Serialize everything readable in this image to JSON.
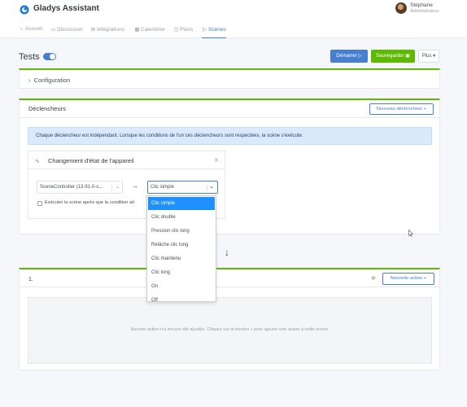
{
  "app": {
    "name": "Gladys Assistant"
  },
  "user": {
    "name": "Stéphane",
    "role": "Administrateur"
  },
  "nav": [
    {
      "label": "Accueil",
      "icon": "home-icon",
      "glyph": "⌂",
      "active": false
    },
    {
      "label": "Discussion",
      "icon": "chat-icon",
      "glyph": "▭",
      "active": false
    },
    {
      "label": "Intégrations",
      "icon": "grid-icon",
      "glyph": "⊞",
      "active": false
    },
    {
      "label": "Calendrier",
      "icon": "calendar-icon",
      "glyph": "▦",
      "active": false
    },
    {
      "label": "Plans",
      "icon": "map-icon",
      "glyph": "◫",
      "active": false
    },
    {
      "label": "Scènes",
      "icon": "play-icon",
      "glyph": "▷",
      "active": true
    }
  ],
  "scene": {
    "title": "Tests",
    "enabled": true,
    "buttons": {
      "start": "Démarrer ▷",
      "save": "Sauvegarder ▣",
      "more": "Plus ▾"
    }
  },
  "config": {
    "label": "Configuration"
  },
  "triggers": {
    "title": "Déclencheurs",
    "new_button": "Nouveau déclencheur +",
    "info": "Chaque déclencheur est indépendant. Lorsque les conditions de l'un ces déclencheurs sont respectées, la scène s'exécute.",
    "box": {
      "title": "Changement d'état de l'appareil",
      "device_value": "SceneController (13-91-0-s...",
      "action_value": "Clic simple",
      "checkbox_label": "Exécuter la scène après que la condition ait"
    },
    "dropdown_options": [
      "Clic simple",
      "Clic double",
      "Pression clic long",
      "Relâche clic long",
      "Clic maintenu",
      "Clic long",
      "On",
      "Off"
    ],
    "selected_option_index": 0
  },
  "actions": {
    "step_label": "1.",
    "new_button": "Nouvelle action +",
    "empty_text": "Aucune action n'a encore été ajoutée. Cliquez sur le bouton + pour ajouter une action à cette scène."
  },
  "colors": {
    "primary": "#467fcf",
    "success": "#5eba00",
    "info_bg": "#dbeafa",
    "selected_option": "#1e90ff"
  }
}
